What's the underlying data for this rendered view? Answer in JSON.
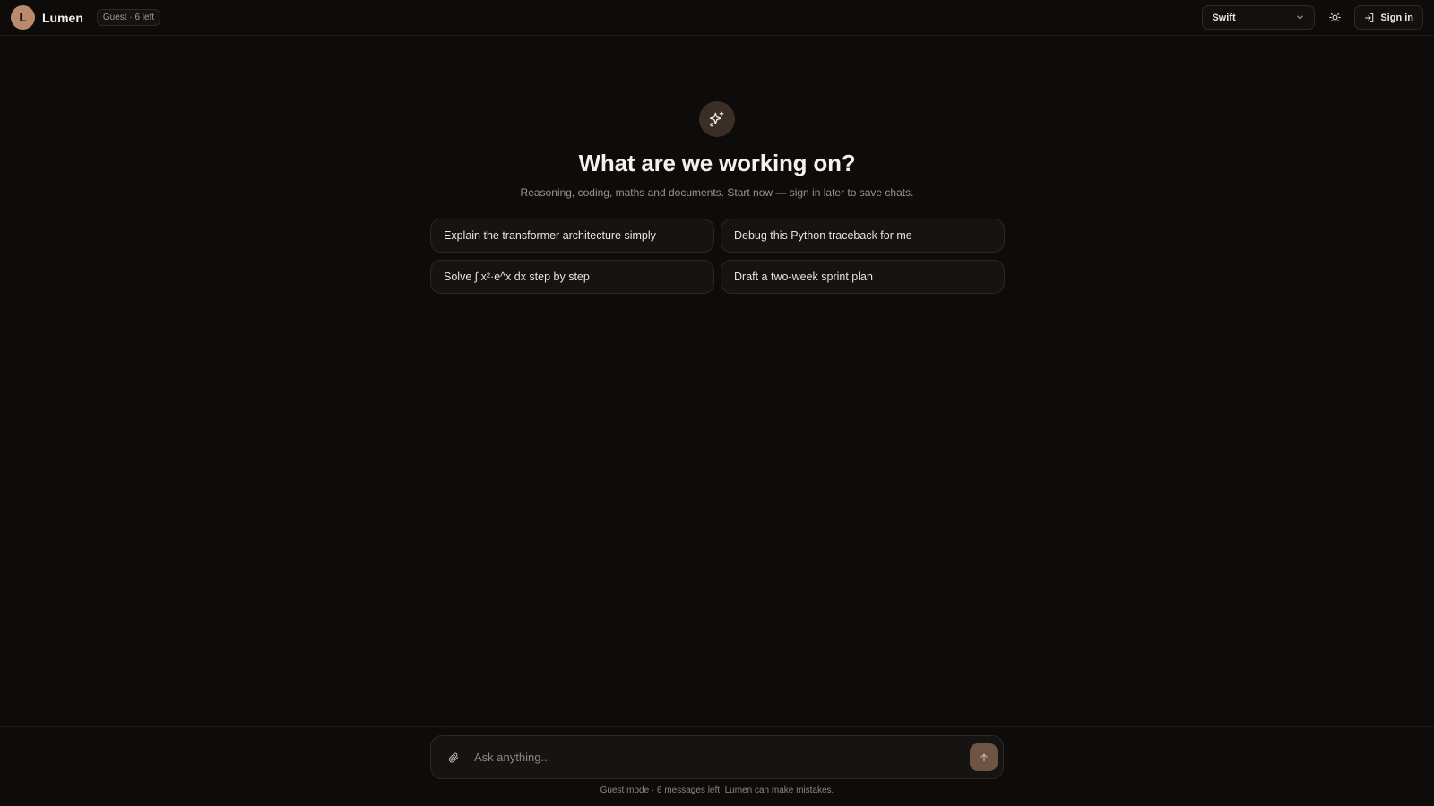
{
  "header": {
    "avatar_initial": "L",
    "brand": "Lumen",
    "guest_badge": "Guest · 6 left",
    "model_selected": "Swift",
    "signin_label": "Sign in"
  },
  "hero": {
    "icon": "sparkles-icon",
    "title": "What are we working on?",
    "subtitle": "Reasoning, coding, maths and documents. Start now — sign in later to save chats."
  },
  "suggestions": [
    "Explain the transformer architecture simply",
    "Debug this Python traceback for me",
    "Solve ∫ x²·e^x dx step by step",
    "Draft a two-week sprint plan"
  ],
  "composer": {
    "placeholder": "Ask anything...",
    "footnote": "Guest mode · 6 messages left. Lumen can make mistakes."
  },
  "colors": {
    "background": "#0d0c0b",
    "accent": "#b98a6e",
    "send": "#6e5443"
  }
}
